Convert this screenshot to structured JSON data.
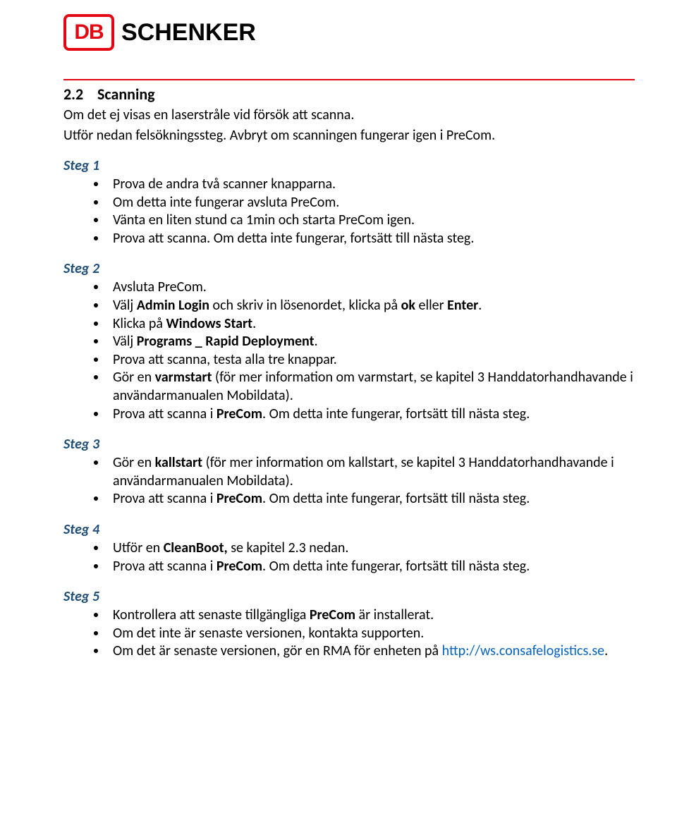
{
  "logo": {
    "db": "DB",
    "schenker": "SCHENKER"
  },
  "section": {
    "number": "2.2",
    "title": "Scanning"
  },
  "intro": {
    "l1": "Om det ej visas en laserstråle vid försök att scanna.",
    "l2": "Utför nedan felsökningssteg. Avbryt om scanningen fungerar igen i PreCom."
  },
  "steps": {
    "s1": {
      "label": "Steg 1",
      "items": {
        "i0": "Prova de andra två scanner knapparna.",
        "i1": "Om detta inte fungerar avsluta PreCom.",
        "i2": " Vänta en liten stund ca 1min och starta PreCom igen.",
        "i3": "Prova att scanna. Om detta inte fungerar, fortsätt till nästa steg."
      }
    },
    "s2": {
      "label": "Steg 2",
      "items": {
        "i0": "Avsluta PreCom.",
        "i1_a": "Välj ",
        "i1_b": "Admin Login",
        "i1_c": " och skriv in lösenordet, klicka på ",
        "i1_d": "ok",
        "i1_e": " eller ",
        "i1_f": "Enter",
        "i1_g": ".",
        "i2_a": "Klicka på ",
        "i2_b": "Windows Start",
        "i2_c": ".",
        "i3_a": "Välj ",
        "i3_b": "Programs _ Rapid Deployment",
        "i3_c": ".",
        "i4": "Prova att scanna, testa alla tre knappar.",
        "i5_a": "Gör en ",
        "i5_b": "varmstart",
        "i5_c": " (för mer information om varmstart, se kapitel 3 Handdatorhandhavande i användarmanualen Mobildata).",
        "i6_a": "Prova att scanna i ",
        "i6_b": "PreCom",
        "i6_c": ". Om detta inte fungerar, fortsätt till nästa steg."
      }
    },
    "s3": {
      "label": "Steg 3",
      "items": {
        "i0_a": "Gör en ",
        "i0_b": "kallstart",
        "i0_c": " (för mer information om kallstart, se kapitel 3 Handdatorhandhavande i användarmanualen Mobildata).",
        "i1_a": "Prova att scanna i ",
        "i1_b": "PreCom",
        "i1_c": ". Om detta inte fungerar, fortsätt till nästa steg."
      }
    },
    "s4": {
      "label": "Steg 4",
      "items": {
        "i0_a": "Utför en ",
        "i0_b": "CleanBoot,",
        "i0_c": " se kapitel 2.3 nedan.",
        "i1_a": "Prova att scanna i ",
        "i1_b": "PreCom",
        "i1_c": ". Om detta inte fungerar, fortsätt till nästa steg."
      }
    },
    "s5": {
      "label": "Steg 5",
      "items": {
        "i0_a": "Kontrollera att senaste tillgängliga ",
        "i0_b": "PreCom",
        "i0_c": " är installerat.",
        "i1": "Om det inte är senaste versionen, kontakta supporten.",
        "i2_a": "Om det är senaste versionen, gör en RMA för enheten på ",
        "i2_link": "http://ws.consafelogistics.se",
        "i2_c": "."
      }
    }
  }
}
